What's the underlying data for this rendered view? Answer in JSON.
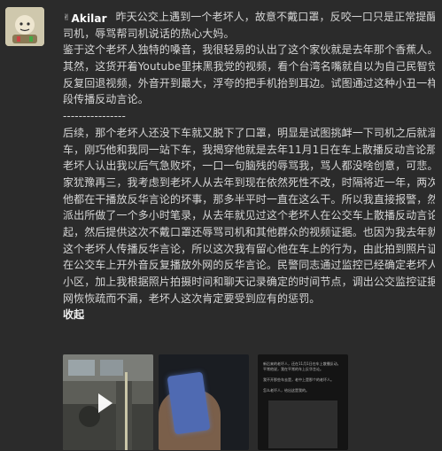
{
  "post": {
    "author": "Akilar",
    "lines": [
      "昨天公交上遇到一个老坏人，故意不戴口罩，反咬一口只是正常提醒他的",
      "司机，辱骂帮司机说话的热心大妈。",
      "鉴于这个老坏人独特的嗓音，我很轻易的认出了这个家伙就是去年那个香蕉人。果不",
      "其然，这货开着Youtube里抹黑我党的视频，看个台湾名嘴就自以为自己民智觉醒，",
      "反复回退视频，外音开到最大，浮夸的把手机抬到耳边。试图通过这种小丑一样的手",
      "段传播反动言论。",
      "----------------",
      "后续，那个老坏人还没下车就又脱下了口罩，明显是试图挑衅一下司机之后就溜下",
      "车，刚巧他和我同一站下车，我揭穿他就是去年11月1日在车上散播反动言论那货，",
      "老坏人认出我以后气急败坏，一口一句脑残的辱骂我，骂人都没啥创意，可悲。回到",
      "家犹豫再三，我考虑到老坏人从去年到现在依然死性不改，时隔将近一年，两次遇到",
      "他都在干播放反华言论的坏事，那多半平时一直在这么干。所以我直接报警，然后去",
      "派出所做了一个多小时笔录，从去年就见过这个老坏人在公交车上散播反动言论说",
      "起，然后提供这次不戴口罩还辱骂司机和其他群众的视频证据。也因为我去年就见过",
      "这个老坏人传播反华言论，所以这次我有留心他在车上的行为，由此拍到照片证明他",
      "在公交车上开外音反复播放外网的反华言论。民警同志通过监控已经确定老坏人所在",
      "小区，加上我根据照片拍摄时间和聊天记录确定的时间节点，调出公交监控证据。天",
      "网恢恢疏而不漏，老坏人这次肯定要受到应有的惩罚。"
    ],
    "footer": "收起"
  },
  "screenshot_text": [
    "新后来的老坏人，还在11月1日在车上散播反动，平常他说，我在平常的车上反华言论。",
    "我不开那些车去是，老中上是那个的老坏人。",
    "怎么老坏人，给出这是我的。"
  ],
  "icons": {
    "author_badge": "hand-icon",
    "play": "play-icon"
  }
}
